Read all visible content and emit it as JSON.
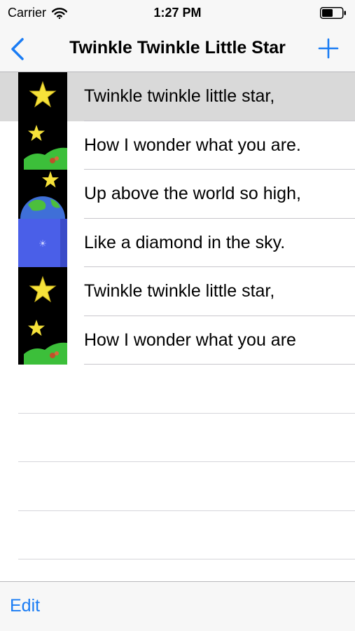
{
  "status_bar": {
    "carrier": "Carrier",
    "time": "1:27 PM",
    "wifi_icon": "wifi-icon",
    "battery_icon": "battery-icon"
  },
  "nav": {
    "title": "Twinkle Twinkle Little Star",
    "back_icon": "chevron-left-icon",
    "add_icon": "plus-icon"
  },
  "rows": [
    {
      "text": "Twinkle twinkle little star,",
      "thumbnail": "star-on-black",
      "selected": true
    },
    {
      "text": "How I wonder what you are.",
      "thumbnail": "star-over-green-hill",
      "selected": false
    },
    {
      "text": "Up above the world so high,",
      "thumbnail": "star-over-earth",
      "selected": false
    },
    {
      "text": "Like a diamond in the sky.",
      "thumbnail": "blue-sky-diamond",
      "selected": false
    },
    {
      "text": "Twinkle twinkle little star,",
      "thumbnail": "star-on-black",
      "selected": false
    },
    {
      "text": "How I wonder what you are",
      "thumbnail": "star-over-green-hill",
      "selected": false
    }
  ],
  "toolbar": {
    "edit_label": "Edit"
  },
  "colors": {
    "accent": "#1a7cf4",
    "selected_row": "#d9d9d9",
    "bar_background": "#f7f7f7"
  }
}
